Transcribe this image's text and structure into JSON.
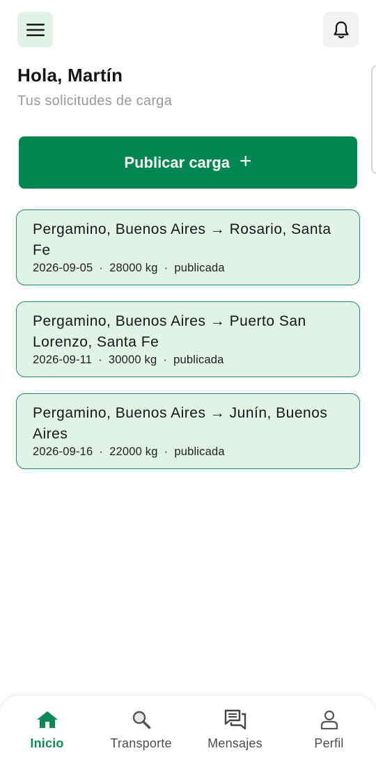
{
  "header": {
    "greeting": "Hola, Martín",
    "subtitle": "Tus solicitudes de carga",
    "menu_icon": "menu-icon",
    "notification_icon": "bell-icon"
  },
  "actions": {
    "publish_label": "Publicar carga",
    "publish_icon_glyph": "+"
  },
  "requests": [
    {
      "route": "Pergamino, Buenos Aires → Rosario, Santa Fe",
      "date": "2026-09-05",
      "weight": "28000 kg",
      "status": "publicada"
    },
    {
      "route": "Pergamino, Buenos Aires → Puerto San Lorenzo, Santa Fe",
      "date": "2026-09-11",
      "weight": "30000 kg",
      "status": "publicada"
    },
    {
      "route": "Pergamino, Buenos Aires → Junín, Buenos Aires",
      "date": "2026-09-16",
      "weight": "22000 kg",
      "status": "publicada"
    }
  ],
  "meta_separator": "·",
  "nav": {
    "items": [
      {
        "label": "Inicio",
        "icon": "home-icon",
        "active": true
      },
      {
        "label": "Transporte",
        "icon": "search-icon",
        "active": false
      },
      {
        "label": "Mensajes",
        "icon": "chat-icon",
        "active": false
      },
      {
        "label": "Perfil",
        "icon": "user-icon",
        "active": false
      }
    ]
  },
  "colors": {
    "brand": "#008751",
    "card_bg": "#e1f3e9",
    "card_border": "#1b8f5c",
    "nav_active": "#0b8a55"
  }
}
